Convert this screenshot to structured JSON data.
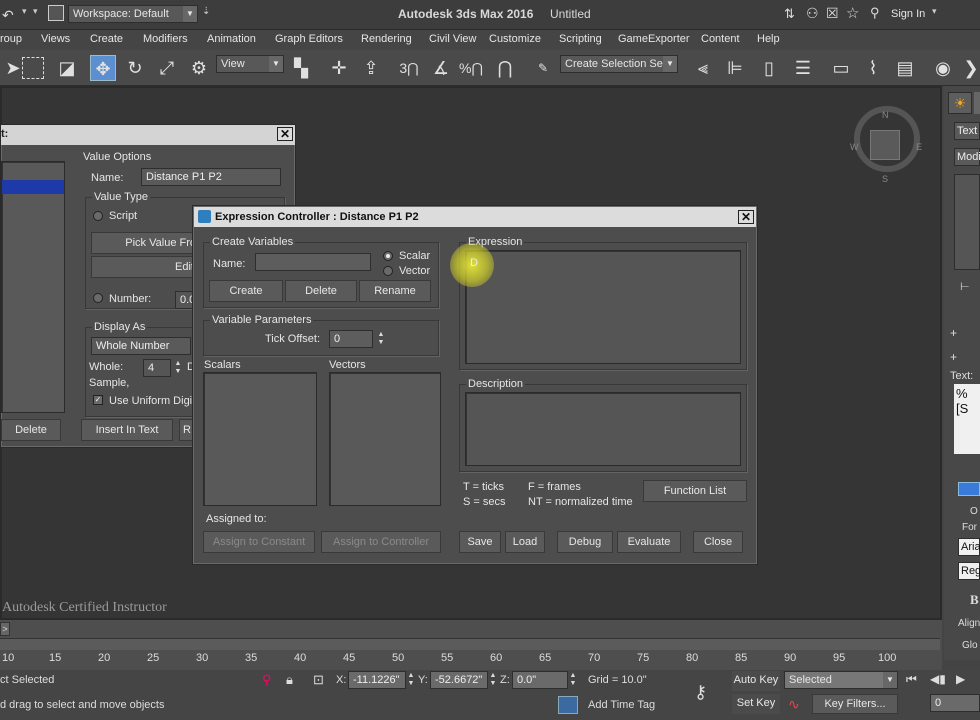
{
  "titlebar": {
    "workspace": "Workspace: Default",
    "app_title": "Autodesk 3ds Max 2016",
    "doc_title": "Untitled",
    "sign_in": "Sign In"
  },
  "menu": [
    "roup",
    "Views",
    "Create",
    "Modifiers",
    "Animation",
    "Graph Editors",
    "Rendering",
    "Civil View",
    "Customize",
    "Scripting",
    "GameExporter",
    "Content",
    "Help"
  ],
  "toolbar": {
    "view_label": "View",
    "selection_set": "Create Selection Se"
  },
  "viewport": {
    "watermark": "Autodesk Certified Instructor",
    "compass": {
      "n": "N",
      "s": "S",
      "e": "E",
      "w": "W"
    }
  },
  "bg_dialog": {
    "value_options": "Value Options",
    "name_label": "Name:",
    "name_value": "Distance P1 P2",
    "value_type": "Value Type",
    "script": "Script",
    "pick_value": "Pick Value Fro",
    "edit": "Edit",
    "number_label": "Number:",
    "number_value": "0.0",
    "display_as": "Display As",
    "whole_number": "Whole Number",
    "whole_label": "Whole:",
    "whole_value": "4",
    "whole_extra": "D",
    "sample": "Sample,",
    "uniform": "Use Uniform Digit",
    "delete": "Delete",
    "insert_text": "Insert In Text",
    "insert_extra": "R",
    "title_frag": "t:"
  },
  "expr": {
    "title": "Expression Controller : Distance P1 P2",
    "create_vars": "Create Variables",
    "name_label": "Name:",
    "name_value": "",
    "scalar": "Scalar",
    "vector": "Vector",
    "create": "Create",
    "delete": "Delete",
    "rename": "Rename",
    "var_params": "Variable Parameters",
    "tick_offset": "Tick Offset:",
    "tick_value": "0",
    "scalars": "Scalars",
    "vectors": "Vectors",
    "expression": "Expression",
    "expression_text": "D",
    "description": "Description",
    "legend_t": "T = ticks",
    "legend_f": "F = frames",
    "legend_s": "S = secs",
    "legend_nt": "NT = normalized time",
    "function_list": "Function List",
    "assigned_to": "Assigned to:",
    "assign_constant": "Assign to Constant",
    "assign_controller": "Assign to Controller",
    "save": "Save",
    "load": "Load",
    "debug": "Debug",
    "evaluate": "Evaluate",
    "close": "Close"
  },
  "right": {
    "text": "Text",
    "modi": "Modi",
    "text2": "Text:",
    "textval": "%[S",
    "o": "O",
    "for": "For",
    "aria": "Aria",
    "reg": "Reg",
    "b": "B",
    "align": "Align",
    "glob": "Glo"
  },
  "timeline": {
    "ticks": [
      "10",
      "15",
      "20",
      "25",
      "30",
      "35",
      "40",
      "45",
      "50",
      "55",
      "60",
      "65",
      "70",
      "75",
      "80",
      "85",
      "90",
      "95",
      "100"
    ],
    "arrow": ">"
  },
  "status": {
    "selected": "ct Selected",
    "prompt": "d drag to select and move objects",
    "x_label": "X:",
    "x": "-11.1226\"",
    "y_label": "Y:",
    "y": "-52.6672\"",
    "z_label": "Z:",
    "z": "0.0\"",
    "grid": "Grid = 10.0\"",
    "add_time_tag": "Add Time Tag",
    "auto_key": "Auto Key",
    "set_key": "Set Key",
    "selected_dd": "Selected",
    "key_filters": "Key Filters...",
    "frame": "0"
  }
}
